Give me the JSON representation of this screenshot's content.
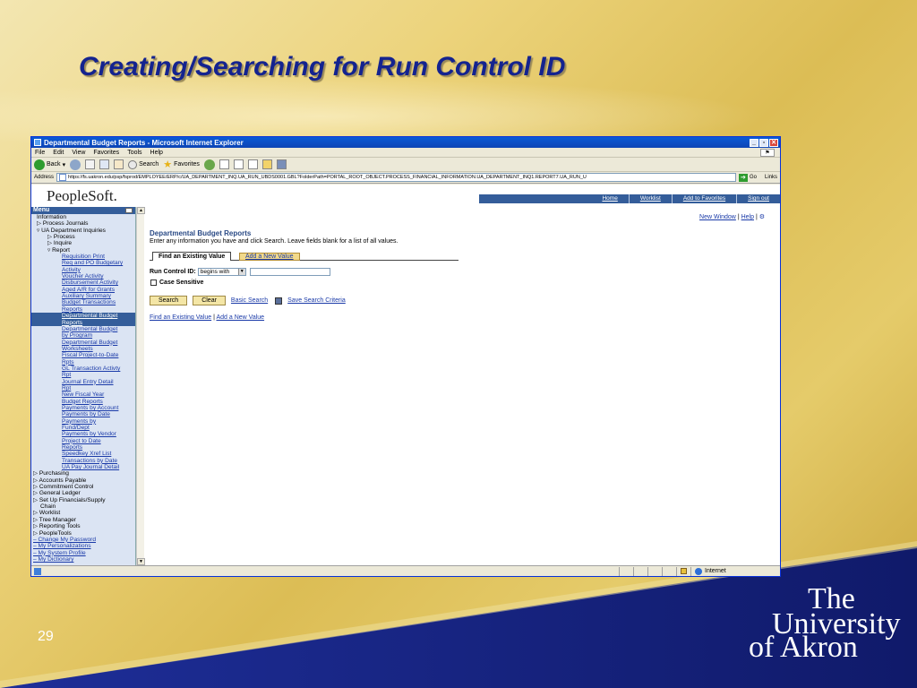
{
  "slide": {
    "title": "Creating/Searching for Run Control ID",
    "number": "29",
    "logo": {
      "line1": "The",
      "line2": "University",
      "line3": "of Akron"
    }
  },
  "browser": {
    "title": "Departmental Budget Reports - Microsoft Internet Explorer",
    "menu": [
      "File",
      "Edit",
      "View",
      "Favorites",
      "Tools",
      "Help"
    ],
    "toolbar": {
      "back": "Back",
      "search": "Search",
      "favorites": "Favorites"
    },
    "address_label": "Address",
    "address_value": "https://fs.uakron.edu/psp/fsprod/EMPLOYEE/ERP/c/UA_DEPARTMENT_INQ.UA_RUN_UBDS0001.GBL?FolderPath=PORTAL_ROOT_OBJECT.PROCESS_FINANCIAL_INFORMATION.UA_DEPARTMENT_INQ1.REPORT7.UA_RUN_U",
    "go": "Go",
    "links": "Links",
    "status_zone": "Internet"
  },
  "peoplesoft": {
    "logo": "PeopleSoft.",
    "nav": [
      "Home",
      "Worklist",
      "Add to Favorites",
      "Sign out"
    ],
    "menu_title": "Menu",
    "menu_items": [
      {
        "text": "Information",
        "link": false,
        "indent": 6
      },
      {
        "text": "▷ Process Journals",
        "link": false,
        "indent": 6
      },
      {
        "text": "▿ UA Department Inquiries",
        "link": false,
        "indent": 6
      },
      {
        "text": "▷ Process",
        "link": false,
        "indent": 18
      },
      {
        "text": "▷ Inquire",
        "link": false,
        "indent": 18
      },
      {
        "text": "▿ Report",
        "link": false,
        "indent": 18
      },
      {
        "text": "Requisition Print",
        "link": true,
        "indent": 34
      },
      {
        "text": "Req and PO Budgetary",
        "link": true,
        "indent": 34
      },
      {
        "text": "Activity",
        "link": true,
        "indent": 34
      },
      {
        "text": "Voucher Activity",
        "link": true,
        "indent": 34
      },
      {
        "text": "Disbursement Activity",
        "link": true,
        "indent": 34
      },
      {
        "text": "Aged A/R for Grants",
        "link": true,
        "indent": 34
      },
      {
        "text": "Auxiliary Summary",
        "link": true,
        "indent": 34
      },
      {
        "text": "Budget Transactions",
        "link": true,
        "indent": 34
      },
      {
        "text": "Reports",
        "link": true,
        "indent": 34
      },
      {
        "text": "Departmental Budget",
        "link": true,
        "indent": 34,
        "selected": true
      },
      {
        "text": "Reports",
        "link": true,
        "indent": 34,
        "selected": true
      },
      {
        "text": "Departmental Budget",
        "link": true,
        "indent": 34
      },
      {
        "text": "by Program",
        "link": true,
        "indent": 34
      },
      {
        "text": "Departmental Budget",
        "link": true,
        "indent": 34
      },
      {
        "text": "Worksheets",
        "link": true,
        "indent": 34
      },
      {
        "text": "Fiscal Project-to-Date",
        "link": true,
        "indent": 34
      },
      {
        "text": "Rpts",
        "link": true,
        "indent": 34
      },
      {
        "text": "GL Transaction Activty",
        "link": true,
        "indent": 34
      },
      {
        "text": "Rpt",
        "link": true,
        "indent": 34
      },
      {
        "text": "Journal Entry Detail",
        "link": true,
        "indent": 34
      },
      {
        "text": "Rpt",
        "link": true,
        "indent": 34
      },
      {
        "text": "New Fiscal Year",
        "link": true,
        "indent": 34
      },
      {
        "text": "Budget Reports",
        "link": true,
        "indent": 34
      },
      {
        "text": "Payments by Account",
        "link": true,
        "indent": 34
      },
      {
        "text": "Payments by Date",
        "link": true,
        "indent": 34
      },
      {
        "text": "Payments by",
        "link": true,
        "indent": 34
      },
      {
        "text": "Fund/Dept",
        "link": true,
        "indent": 34
      },
      {
        "text": "Payments by Vendor",
        "link": true,
        "indent": 34
      },
      {
        "text": "Project to Date",
        "link": true,
        "indent": 34
      },
      {
        "text": "Reports",
        "link": true,
        "indent": 34
      },
      {
        "text": "Speedkey Xref List",
        "link": true,
        "indent": 34
      },
      {
        "text": "Transactions by Date",
        "link": true,
        "indent": 34
      },
      {
        "text": "UA Pay Journal Detail",
        "link": true,
        "indent": 34
      },
      {
        "text": "▷ Purchasing",
        "link": false,
        "indent": 2
      },
      {
        "text": "▷ Accounts Payable",
        "link": false,
        "indent": 2
      },
      {
        "text": "▷ Commitment Control",
        "link": false,
        "indent": 2
      },
      {
        "text": "▷ General Ledger",
        "link": false,
        "indent": 2
      },
      {
        "text": "▷ Set Up Financials/Supply",
        "link": false,
        "indent": 2
      },
      {
        "text": "Chain",
        "link": false,
        "indent": 10
      },
      {
        "text": "▷ Worklist",
        "link": false,
        "indent": 2
      },
      {
        "text": "▷ Tree Manager",
        "link": false,
        "indent": 2
      },
      {
        "text": "▷ Reporting Tools",
        "link": false,
        "indent": 2
      },
      {
        "text": "▷ PeopleTools",
        "link": false,
        "indent": 2
      },
      {
        "text": "– Change My Password",
        "link": true,
        "indent": 2
      },
      {
        "text": "– My Personalizations",
        "link": true,
        "indent": 2
      },
      {
        "text": "– My System Profile",
        "link": true,
        "indent": 2
      },
      {
        "text": "– My Dictionary",
        "link": true,
        "indent": 2
      }
    ],
    "top_links": {
      "new_window": "New Window",
      "help": "Help"
    },
    "page_title": "Departmental Budget Reports",
    "instructions": "Enter any information you have and click Search. Leave fields blank for a list of all values.",
    "tabs": {
      "find": "Find an Existing Value",
      "add": "Add a New Value"
    },
    "run_control_label": "Run Control ID:",
    "operator_value": "begins with",
    "run_control_value": "",
    "case_sensitive": "Case Sensitive",
    "buttons": {
      "search": "Search",
      "clear": "Clear"
    },
    "basic_search": "Basic Search",
    "save_search": "Save Search Criteria",
    "bottom_links": {
      "find": "Find an Existing Value",
      "add": "Add a New Value"
    }
  }
}
